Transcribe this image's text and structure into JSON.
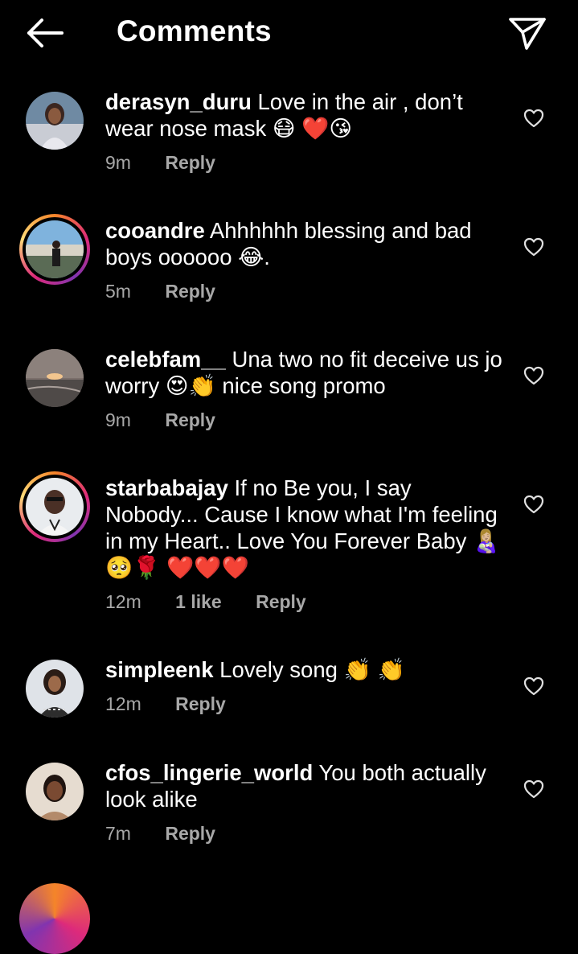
{
  "header": {
    "title": "Comments",
    "back_icon": "arrow-left-icon",
    "share_icon": "paper-plane-icon"
  },
  "colors": {
    "background": "#000000",
    "text": "#ffffff",
    "meta": "#a8a8a8",
    "heart_emoji": "#e02020"
  },
  "comments": [
    {
      "username": "derasyn_duru",
      "text": "Love in the air , don’t wear nose mask 😷 ❤️😘",
      "time": "9m",
      "reply": "Reply"
    },
    {
      "username": "cooandre",
      "text": "Ahhhhhh blessing and bad boys oooooo 😂.",
      "time": "5m",
      "reply": "Reply"
    },
    {
      "username": "celebfam__",
      "text": "Una two no fit deceive us jo worry 😍👏 nice song promo",
      "time": "9m",
      "reply": "Reply"
    },
    {
      "username": "starbabajay",
      "text": "If no Be you, I say Nobody... Cause I know what I'm feeling in my Heart.. Love You Forever Baby 👩🏼‍🍼🥺🌹 ❤️❤️❤️",
      "time": "12m",
      "likes": "1 like",
      "reply": "Reply"
    },
    {
      "username": "simpleenk",
      "text": "Lovely song 👏 👏",
      "time": "12m",
      "reply": "Reply"
    },
    {
      "username": "cfos_lingerie_world",
      "text": "You both actually look alike",
      "time": "7m",
      "reply": "Reply"
    }
  ]
}
